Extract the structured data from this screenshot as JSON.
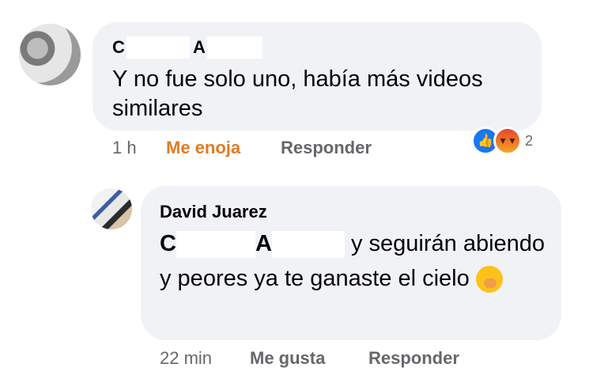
{
  "comment": {
    "author_first_initial": "C",
    "author_second_initial": "A",
    "text": "Y no fue solo uno, había más videos similares",
    "time": "1 h",
    "reaction_label": "Me enoja",
    "reply_label": "Responder",
    "reaction_count": "2",
    "reaction_icons": [
      "like-icon",
      "angry-icon"
    ],
    "reaction_color": "#e17b22"
  },
  "reply": {
    "author": "David Juarez",
    "mention_first": "C",
    "mention_second": "A",
    "text_after_mention": "y seguirán abiendo y peores ya te ganaste el cielo",
    "emoji": "hand-over-mouth-emoji",
    "time": "22 min",
    "like_label": "Me gusta",
    "reply_label": "Responder"
  }
}
